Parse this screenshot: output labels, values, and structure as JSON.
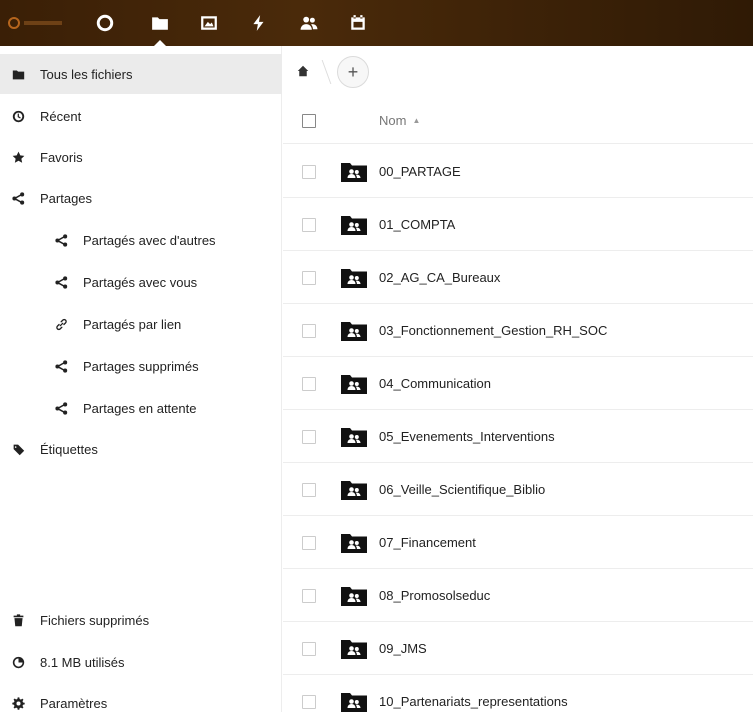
{
  "header": {
    "apps": [
      {
        "name": "dashboard",
        "icon": "circle-icon"
      },
      {
        "name": "files",
        "icon": "folder-icon",
        "active": true
      },
      {
        "name": "photos",
        "icon": "image-icon"
      },
      {
        "name": "activity",
        "icon": "lightning-icon"
      },
      {
        "name": "contacts",
        "icon": "users-icon"
      },
      {
        "name": "calendar",
        "icon": "calendar-icon"
      }
    ]
  },
  "sidebar": {
    "items": [
      {
        "label": "Tous les fichiers",
        "icon": "folder-icon",
        "active": true
      },
      {
        "label": "Récent",
        "icon": "clock-icon"
      },
      {
        "label": "Favoris",
        "icon": "star-icon"
      },
      {
        "label": "Partages",
        "icon": "share-icon"
      },
      {
        "label": "Partagés avec d'autres",
        "icon": "share-icon",
        "sub": true
      },
      {
        "label": "Partagés avec vous",
        "icon": "share-icon",
        "sub": true
      },
      {
        "label": "Partagés par lien",
        "icon": "link-icon",
        "sub": true
      },
      {
        "label": "Partages supprimés",
        "icon": "share-deleted-icon",
        "sub": true
      },
      {
        "label": "Partages en attente",
        "icon": "share-icon",
        "sub": true
      },
      {
        "label": "Étiquettes",
        "icon": "tag-icon"
      }
    ],
    "footer": [
      {
        "label": "Fichiers supprimés",
        "icon": "trash-icon"
      },
      {
        "label": "8.1 MB utilisés",
        "icon": "pie-icon"
      },
      {
        "label": "Paramètres",
        "icon": "gear-icon"
      }
    ]
  },
  "main": {
    "add_label": "+",
    "column_name": "Nom",
    "sort_indicator": "▲",
    "files": [
      "00_PARTAGE",
      "01_COMPTA",
      "02_AG_CA_Bureaux",
      "03_Fonctionnement_Gestion_RH_SOC",
      "04_Communication",
      "05_Evenements_Interventions",
      "06_Veille_Scientifique_Biblio",
      "07_Financement",
      "08_Promosolseduc",
      "09_JMS",
      "10_Partenariats_representations"
    ]
  },
  "colors": {
    "header_bg": "#3a1f06",
    "active_nav_bg": "#ebebeb",
    "folder": "#111111"
  }
}
